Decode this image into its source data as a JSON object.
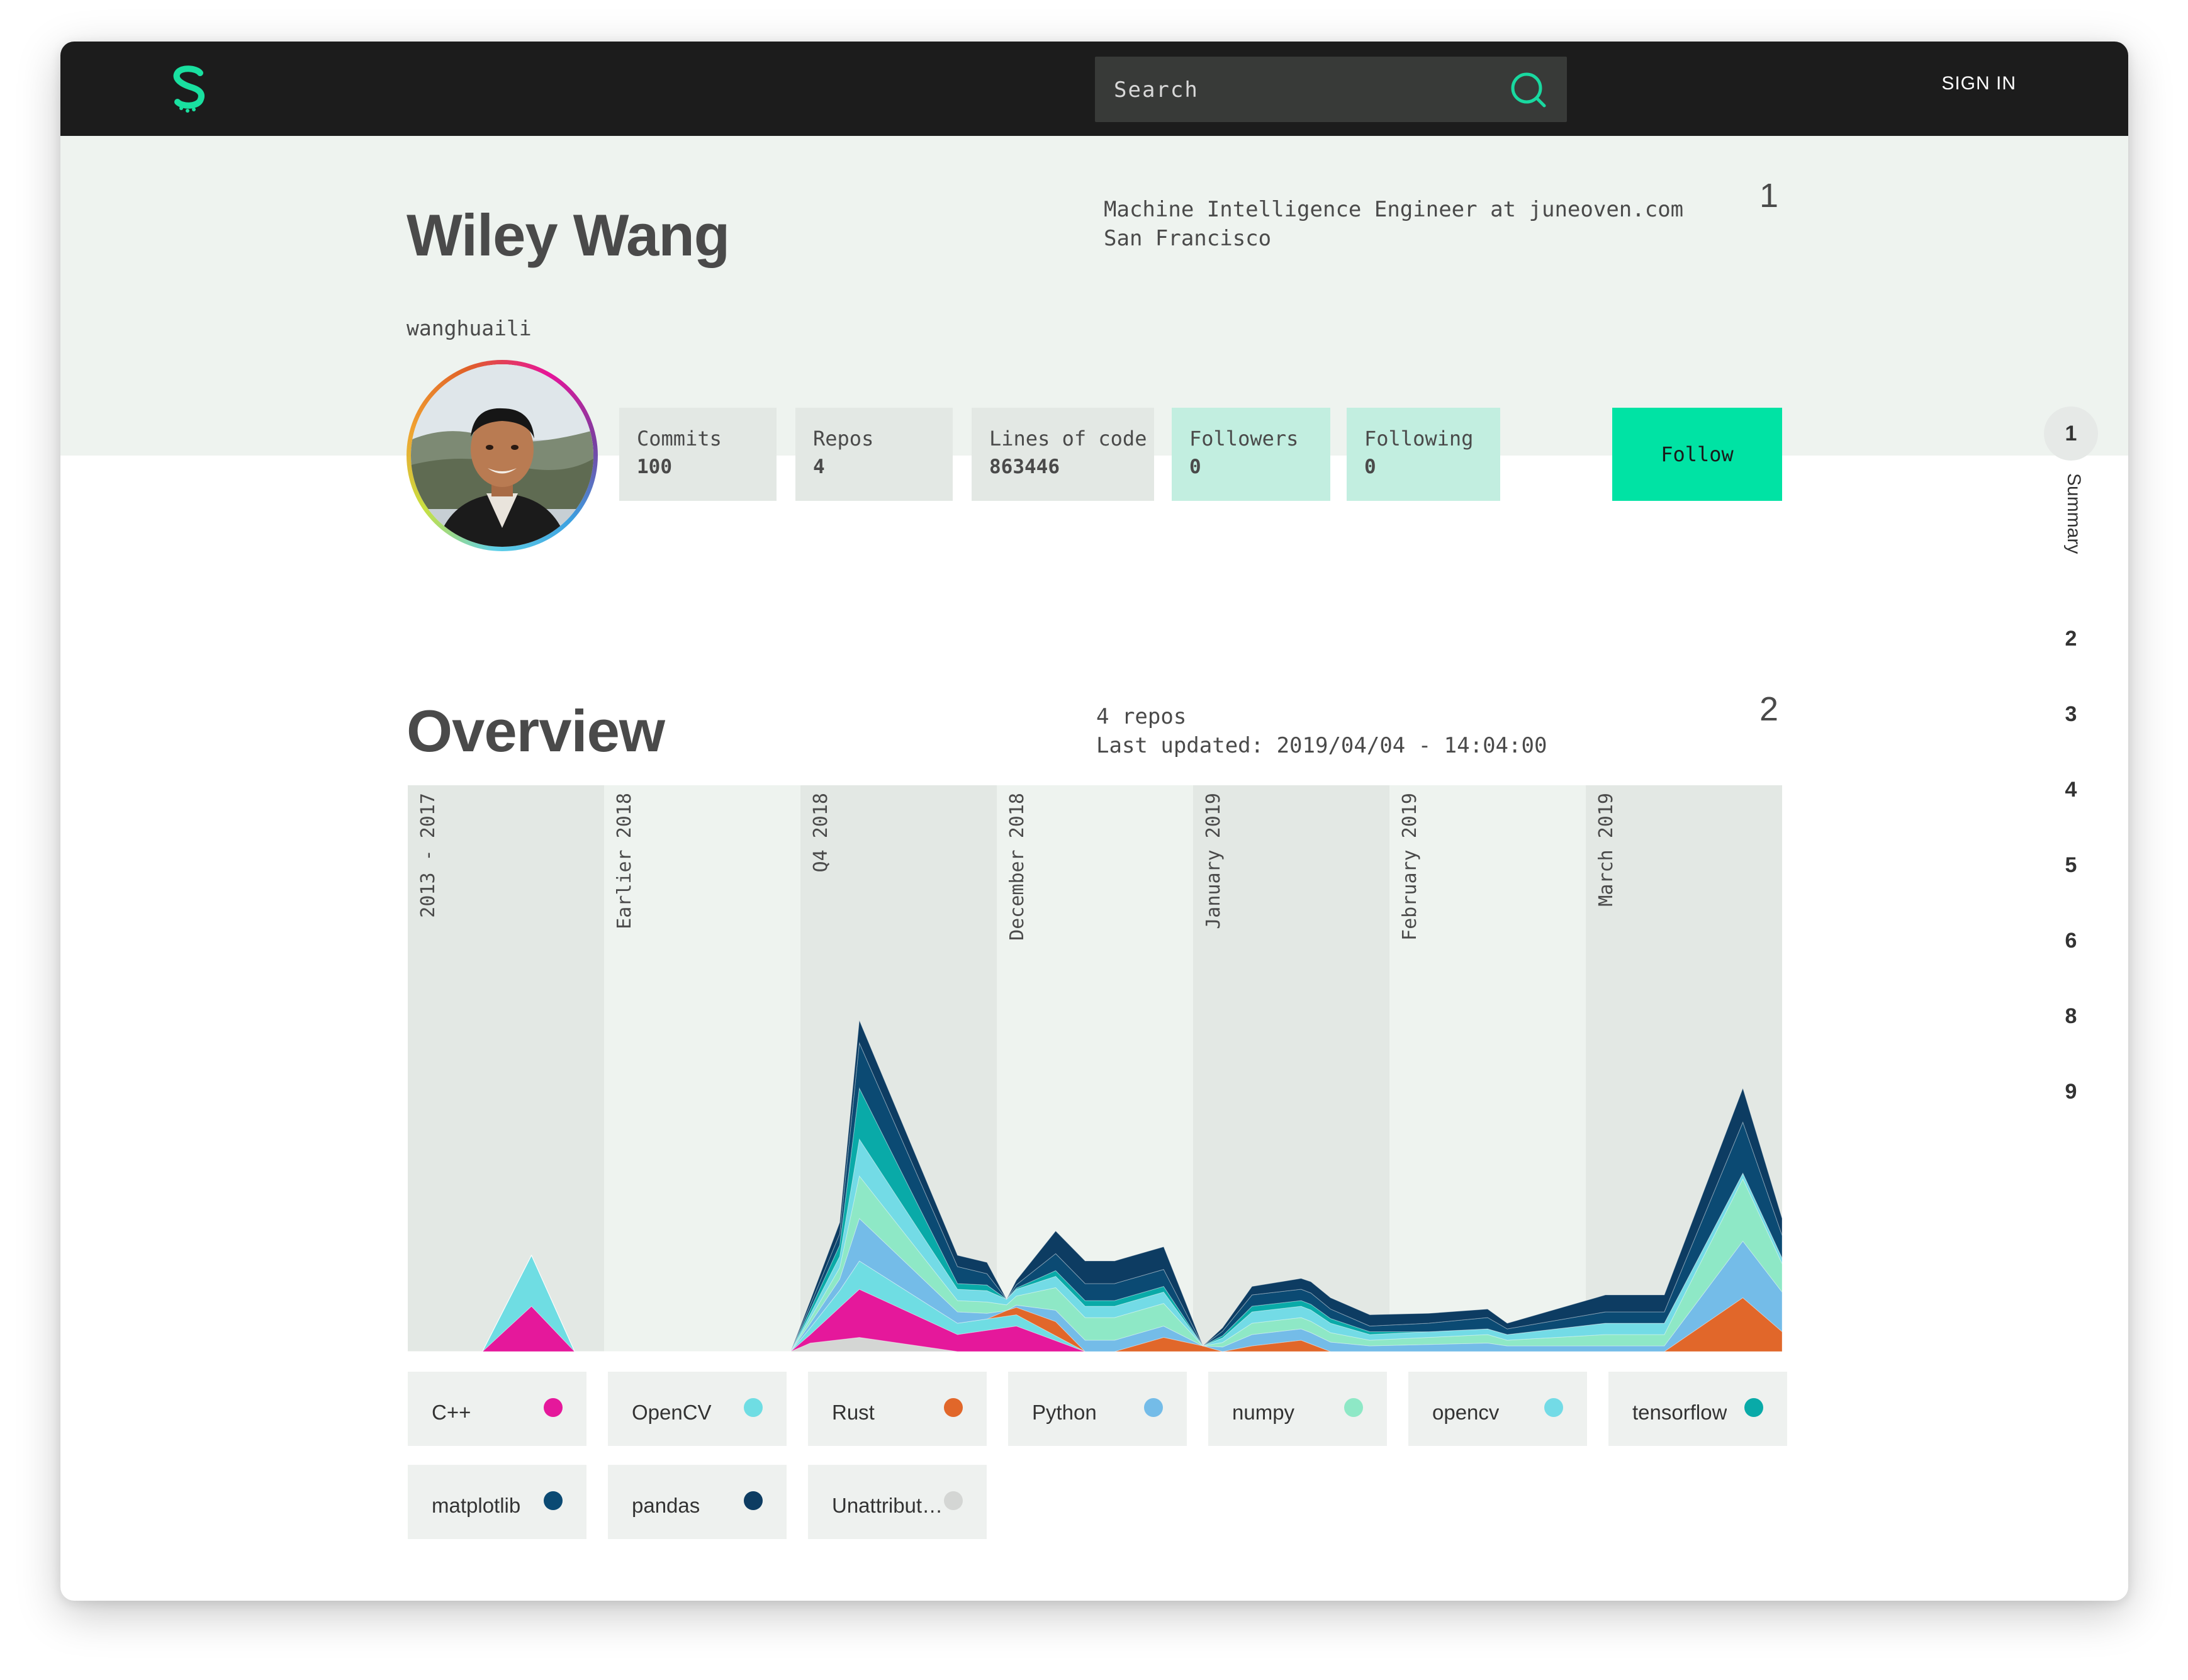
{
  "topbar": {
    "search_placeholder": "Search",
    "signin_label": "SIGN IN"
  },
  "profile": {
    "name": "Wiley Wang",
    "username": "wanghuaili",
    "bio_line1": "Machine Intelligence Engineer at juneoven.com",
    "bio_line2": "San Francisco",
    "section_number": "1",
    "stats": [
      {
        "label": "Commits",
        "value": "100"
      },
      {
        "label": "Repos",
        "value": "4"
      },
      {
        "label": "Lines of code",
        "value": "863446"
      },
      {
        "label": "Followers",
        "value": "0"
      },
      {
        "label": "Following",
        "value": "0"
      }
    ],
    "follow_label": "Follow"
  },
  "overview": {
    "title": "Overview",
    "repos_text": "4 repos",
    "updated_text": "Last updated: 2019/04/04 - 14:04:00",
    "section_number": "2"
  },
  "chart_data": {
    "type": "area",
    "periods": [
      "2013 - 2017",
      "Earlier 2018",
      "Q4 2018",
      "December 2018",
      "January 2019",
      "February 2019",
      "March 2019"
    ],
    "series": [
      {
        "name": "Unattributed",
        "color": "#d4d6d4",
        "points": [
          [
            0,
            0
          ],
          [
            0.5,
            0
          ],
          [
            1.95,
            0
          ],
          [
            2.05,
            0.015
          ],
          [
            2.3,
            0.025
          ],
          [
            2.8,
            0
          ],
          [
            3.1,
            0
          ],
          [
            3.5,
            0
          ],
          [
            3.95,
            0
          ],
          [
            4.15,
            0
          ],
          [
            4.6,
            0
          ],
          [
            5.2,
            0
          ],
          [
            5.6,
            0
          ],
          [
            6.1,
            0
          ],
          [
            6.4,
            0
          ],
          [
            6.8,
            0
          ],
          [
            7,
            0
          ]
        ]
      },
      {
        "name": "C++",
        "color": "#e5189b",
        "points": [
          [
            0,
            0
          ],
          [
            0.38,
            0
          ],
          [
            0.63,
            0.08
          ],
          [
            0.85,
            0
          ],
          [
            1.95,
            0
          ],
          [
            2.05,
            0.015
          ],
          [
            2.3,
            0.085
          ],
          [
            2.8,
            0.03
          ],
          [
            3.1,
            0.045
          ],
          [
            3.45,
            0
          ],
          [
            3.95,
            0
          ],
          [
            4.6,
            0
          ],
          [
            5.2,
            0
          ],
          [
            5.6,
            0
          ],
          [
            6.1,
            0
          ],
          [
            6.4,
            0
          ],
          [
            6.8,
            0
          ],
          [
            7,
            0
          ]
        ]
      },
      {
        "name": "OpenCV",
        "color": "#6fdde3",
        "points": [
          [
            0,
            0
          ],
          [
            0.38,
            0
          ],
          [
            0.63,
            0.09
          ],
          [
            0.85,
            0
          ],
          [
            1.95,
            0
          ],
          [
            2.2,
            0.03
          ],
          [
            2.3,
            0.05
          ],
          [
            2.8,
            0.02
          ],
          [
            3.1,
            0.02
          ],
          [
            3.45,
            0
          ],
          [
            3.95,
            0
          ],
          [
            4.6,
            0
          ],
          [
            5.2,
            0
          ],
          [
            5.6,
            0
          ],
          [
            6.1,
            0
          ],
          [
            6.4,
            0
          ],
          [
            6.8,
            0
          ],
          [
            7,
            0
          ]
        ]
      },
      {
        "name": "Rust",
        "color": "#e1672a",
        "points": [
          [
            0,
            0
          ],
          [
            1.95,
            0
          ],
          [
            2.95,
            0
          ],
          [
            3.05,
            0.01
          ],
          [
            3.3,
            0.025
          ],
          [
            3.45,
            0
          ],
          [
            3.6,
            0
          ],
          [
            3.85,
            0.025
          ],
          [
            4.05,
            0.01
          ],
          [
            4.15,
            0
          ],
          [
            4.3,
            0.01
          ],
          [
            4.55,
            0.02
          ],
          [
            4.7,
            0
          ],
          [
            5.2,
            0
          ],
          [
            5.6,
            0
          ],
          [
            6.1,
            0
          ],
          [
            6.4,
            0
          ],
          [
            6.8,
            0.095
          ],
          [
            7,
            0.035
          ]
        ]
      },
      {
        "name": "Python",
        "color": "#74bce8",
        "points": [
          [
            0,
            0
          ],
          [
            1.95,
            0
          ],
          [
            2.2,
            0.02
          ],
          [
            2.3,
            0.075
          ],
          [
            2.8,
            0.02
          ],
          [
            2.95,
            0.01
          ],
          [
            3.05,
            0
          ],
          [
            3.3,
            0.02
          ],
          [
            3.85,
            0.02
          ],
          [
            4.05,
            0
          ],
          [
            4.3,
            0.02
          ],
          [
            4.6,
            0.02
          ],
          [
            4.9,
            0.01
          ],
          [
            5.5,
            0.015
          ],
          [
            5.6,
            0.01
          ],
          [
            6.1,
            0.01
          ],
          [
            6.4,
            0.01
          ],
          [
            6.8,
            0.1
          ],
          [
            7,
            0.07
          ]
        ]
      },
      {
        "name": "numpy",
        "color": "#8ee8c6",
        "points": [
          [
            0,
            0
          ],
          [
            1.95,
            0
          ],
          [
            2.2,
            0.02
          ],
          [
            2.3,
            0.075
          ],
          [
            2.8,
            0.02
          ],
          [
            2.95,
            0.02
          ],
          [
            3.05,
            0.01
          ],
          [
            3.3,
            0.04
          ],
          [
            3.85,
            0.04
          ],
          [
            4.05,
            0
          ],
          [
            4.3,
            0.02
          ],
          [
            4.6,
            0.02
          ],
          [
            4.9,
            0.01
          ],
          [
            5.5,
            0.015
          ],
          [
            5.6,
            0.01
          ],
          [
            6.1,
            0.02
          ],
          [
            6.4,
            0.02
          ],
          [
            6.8,
            0.11
          ],
          [
            7,
            0.05
          ]
        ]
      },
      {
        "name": "opencv",
        "color": "#73dbe6",
        "points": [
          [
            0,
            0
          ],
          [
            1.95,
            0
          ],
          [
            2.2,
            0.02
          ],
          [
            2.3,
            0.065
          ],
          [
            2.8,
            0.02
          ],
          [
            2.95,
            0.02
          ],
          [
            3.05,
            0.01
          ],
          [
            3.3,
            0.02
          ],
          [
            3.85,
            0.02
          ],
          [
            4.05,
            0
          ],
          [
            4.3,
            0.02
          ],
          [
            4.6,
            0.02
          ],
          [
            4.9,
            0.01
          ],
          [
            5.5,
            0.01
          ],
          [
            5.6,
            0.01
          ],
          [
            6.1,
            0.02
          ],
          [
            6.4,
            0.02
          ],
          [
            6.8,
            0.01
          ],
          [
            7,
            0.01
          ]
        ]
      },
      {
        "name": "tensorflow",
        "color": "#09aaa8",
        "points": [
          [
            0,
            0
          ],
          [
            1.95,
            0
          ],
          [
            2.2,
            0.02
          ],
          [
            2.3,
            0.09
          ],
          [
            2.8,
            0.01
          ],
          [
            2.95,
            0.01
          ],
          [
            3.05,
            0
          ],
          [
            3.3,
            0.01
          ],
          [
            3.85,
            0.01
          ],
          [
            4.05,
            0
          ],
          [
            4.3,
            0.01
          ],
          [
            4.6,
            0.01
          ],
          [
            5.2,
            0
          ],
          [
            5.6,
            0
          ],
          [
            6.1,
            0
          ],
          [
            6.4,
            0
          ],
          [
            6.8,
            0
          ],
          [
            7,
            0
          ]
        ]
      },
      {
        "name": "matplotlib",
        "color": "#0b4a73",
        "points": [
          [
            0,
            0
          ],
          [
            1.95,
            0
          ],
          [
            2.2,
            0.02
          ],
          [
            2.3,
            0.08
          ],
          [
            2.8,
            0.03
          ],
          [
            2.95,
            0.02
          ],
          [
            3.05,
            0
          ],
          [
            3.3,
            0.03
          ],
          [
            3.85,
            0.03
          ],
          [
            4.05,
            0
          ],
          [
            4.3,
            0.02
          ],
          [
            4.6,
            0.02
          ],
          [
            4.9,
            0.01
          ],
          [
            5.5,
            0.02
          ],
          [
            5.6,
            0.01
          ],
          [
            6.1,
            0.02
          ],
          [
            6.4,
            0.02
          ],
          [
            6.8,
            0.09
          ],
          [
            7,
            0.04
          ]
        ]
      },
      {
        "name": "pandas",
        "color": "#0d3c62",
        "points": [
          [
            0,
            0
          ],
          [
            1.95,
            0
          ],
          [
            2.2,
            0.02
          ],
          [
            2.3,
            0.04
          ],
          [
            2.8,
            0.02
          ],
          [
            2.95,
            0.02
          ],
          [
            3.05,
            0
          ],
          [
            3.3,
            0.04
          ],
          [
            3.85,
            0.04
          ],
          [
            4.05,
            0
          ],
          [
            4.3,
            0.015
          ],
          [
            4.6,
            0.02
          ],
          [
            4.9,
            0.02
          ],
          [
            5.5,
            0.015
          ],
          [
            5.6,
            0.01
          ],
          [
            6.1,
            0.03
          ],
          [
            6.4,
            0.03
          ],
          [
            6.8,
            0.06
          ],
          [
            7,
            0.03
          ]
        ]
      }
    ]
  },
  "legend": [
    {
      "label": "C++",
      "color": "#e5189b"
    },
    {
      "label": "OpenCV",
      "color": "#6fdde3"
    },
    {
      "label": "Rust",
      "color": "#e1672a"
    },
    {
      "label": "Python",
      "color": "#74bce8"
    },
    {
      "label": "numpy",
      "color": "#8ee8c6"
    },
    {
      "label": "opencv",
      "color": "#73dbe6"
    },
    {
      "label": "tensorflow",
      "color": "#09aaa8"
    },
    {
      "label": "matplotlib",
      "color": "#0b4a73"
    },
    {
      "label": "pandas",
      "color": "#0d3c62"
    },
    {
      "label": "Unattribut…",
      "color": "#d4d6d4"
    }
  ],
  "sidenav": {
    "items": [
      "1",
      "2",
      "3",
      "4",
      "5",
      "6",
      "8",
      "9"
    ],
    "active_label": "Summary"
  }
}
